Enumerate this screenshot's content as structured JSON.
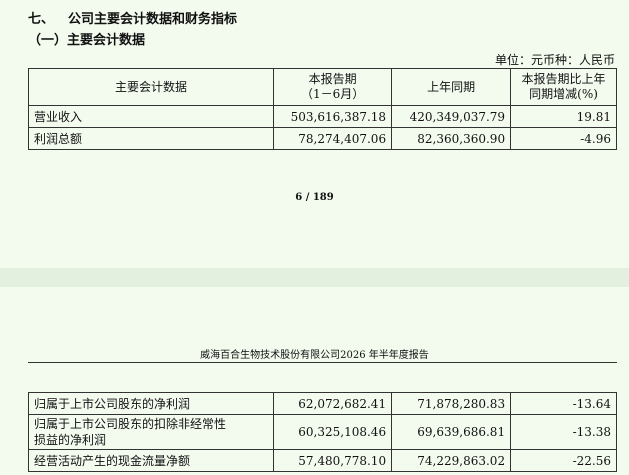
{
  "section": {
    "number": "七、",
    "title": "公司主要会计数据和财务指标"
  },
  "subsection": {
    "title": "（一）主要会计数据"
  },
  "unit_line": "单位：元币种：人民币",
  "table": {
    "headers": {
      "item": "主要会计数据",
      "current_line1": "本报告期",
      "current_line2": "（1－6月）",
      "prior": "上年同期",
      "change_line1": "本报告期比上年",
      "change_line2": "同期增减(%)"
    },
    "rows": [
      {
        "label": "营业收入",
        "current": "503,616,387.18",
        "prior": "420,349,037.79",
        "change": "19.81"
      },
      {
        "label": "利润总额",
        "current": "78,274,407.06",
        "prior": "82,360,360.90",
        "change": "-4.96"
      }
    ]
  },
  "page_number": "6 / 189",
  "report_header": "威海百合生物技术股份有限公司2026 年半年度报告",
  "continued_rows": [
    {
      "label": "归属于上市公司股东的净利润",
      "current": "62,072,682.41",
      "prior": "71,878,280.83",
      "change": "-13.64"
    },
    {
      "label_line1": "归属于上市公司股东的扣除非经常性",
      "label_line2": "损益的净利润",
      "current": "60,325,108.46",
      "prior": "69,639,686.81",
      "change": "-13.38"
    },
    {
      "label": "经营活动产生的现金流量净额",
      "current": "57,480,778.10",
      "prior": "74,229,863.02",
      "change": "-22.56"
    }
  ]
}
